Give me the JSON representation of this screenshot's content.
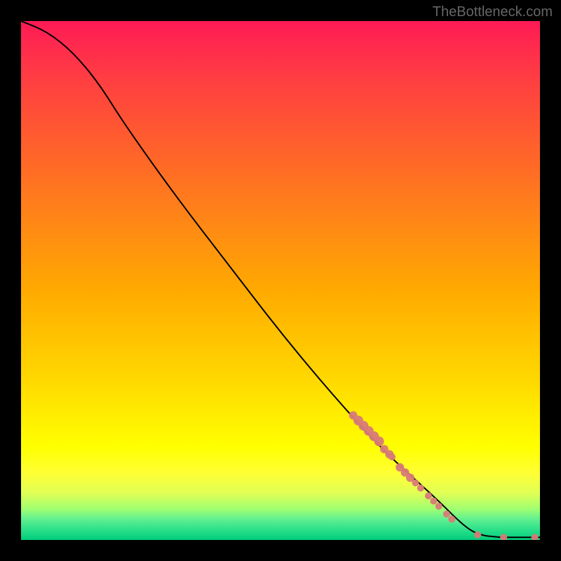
{
  "watermark": "TheBottleneck.com",
  "chart_data": {
    "type": "line",
    "title": "",
    "xlabel": "",
    "ylabel": "",
    "xlim": [
      0,
      100
    ],
    "ylim": [
      0,
      100
    ],
    "curve": [
      {
        "x": 0,
        "y": 100
      },
      {
        "x": 5,
        "y": 98
      },
      {
        "x": 10,
        "y": 94
      },
      {
        "x": 15,
        "y": 88
      },
      {
        "x": 20,
        "y": 80
      },
      {
        "x": 30,
        "y": 66
      },
      {
        "x": 40,
        "y": 53
      },
      {
        "x": 50,
        "y": 40
      },
      {
        "x": 60,
        "y": 28
      },
      {
        "x": 70,
        "y": 17
      },
      {
        "x": 80,
        "y": 8
      },
      {
        "x": 85,
        "y": 3
      },
      {
        "x": 88,
        "y": 1
      },
      {
        "x": 92,
        "y": 0.5
      },
      {
        "x": 96,
        "y": 0.5
      },
      {
        "x": 100,
        "y": 0.5
      }
    ],
    "points": [
      {
        "x": 64,
        "y": 24,
        "r": 6
      },
      {
        "x": 65,
        "y": 23,
        "r": 7
      },
      {
        "x": 66,
        "y": 22,
        "r": 7
      },
      {
        "x": 67,
        "y": 21,
        "r": 7
      },
      {
        "x": 68,
        "y": 20,
        "r": 7
      },
      {
        "x": 69,
        "y": 19,
        "r": 7
      },
      {
        "x": 70,
        "y": 17.5,
        "r": 6
      },
      {
        "x": 71,
        "y": 16.5,
        "r": 6
      },
      {
        "x": 71.5,
        "y": 16,
        "r": 5
      },
      {
        "x": 73,
        "y": 14,
        "r": 6
      },
      {
        "x": 74,
        "y": 13,
        "r": 6
      },
      {
        "x": 75,
        "y": 12,
        "r": 6
      },
      {
        "x": 76,
        "y": 11,
        "r": 5
      },
      {
        "x": 77,
        "y": 10,
        "r": 5
      },
      {
        "x": 78.5,
        "y": 8.5,
        "r": 5
      },
      {
        "x": 79.5,
        "y": 7.5,
        "r": 5
      },
      {
        "x": 80.5,
        "y": 6.5,
        "r": 5
      },
      {
        "x": 82,
        "y": 5,
        "r": 5
      },
      {
        "x": 83,
        "y": 4,
        "r": 5
      },
      {
        "x": 88,
        "y": 1,
        "r": 5
      },
      {
        "x": 93,
        "y": 0.5,
        "r": 5
      },
      {
        "x": 99,
        "y": 0.5,
        "r": 5
      }
    ],
    "background_gradient": {
      "type": "vertical",
      "stops": [
        {
          "pos": 0,
          "color": "#ff1a55"
        },
        {
          "pos": 50,
          "color": "#ffaa00"
        },
        {
          "pos": 85,
          "color": "#ffff00"
        },
        {
          "pos": 100,
          "color": "#00cc7a"
        }
      ]
    }
  }
}
